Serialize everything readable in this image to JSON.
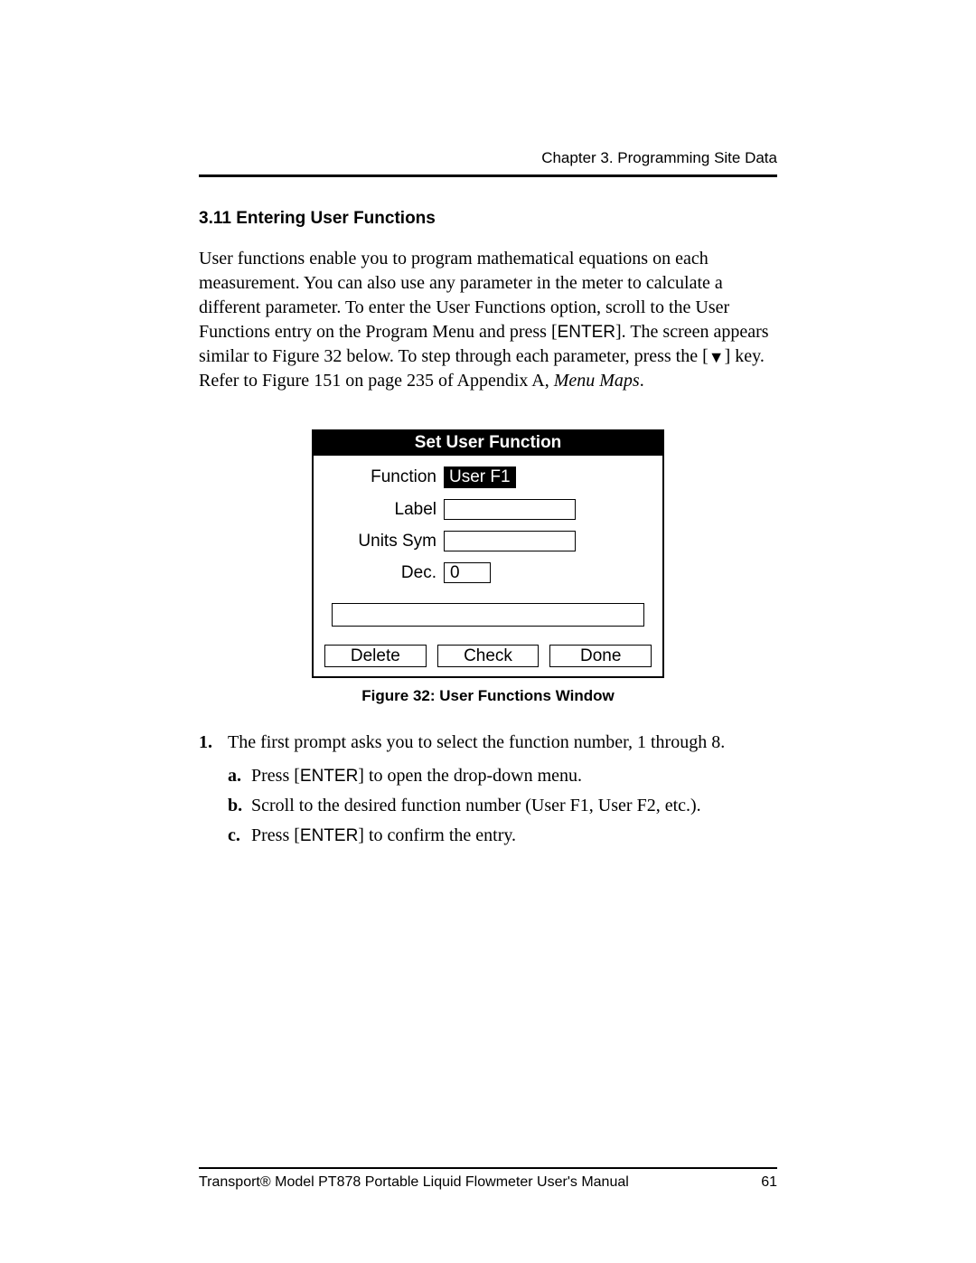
{
  "header": {
    "chapter": "Chapter 3. Programming Site Data"
  },
  "section": {
    "heading": "3.11 Entering User Functions",
    "para_part1": "User functions enable you to program mathematical equations on each measurement. You can also use any parameter in the meter to calculate a different parameter. To enter the User Functions option, scroll to the User Functions entry on the Program Menu and press [",
    "enter1": "ENTER",
    "para_part2": "]. The screen appears similar to Figure 32 below. To step through each parameter, press the [",
    "down_symbol": "▼",
    "para_part3": "] key. Refer to Figure 151 on page 235 of Appendix A, ",
    "menu_maps": "Menu Maps",
    "para_part4": "."
  },
  "window": {
    "title": "Set User Function",
    "rows": {
      "function_label": "Function",
      "function_value": "User F1",
      "label_label": "Label",
      "units_label": "Units Sym",
      "dec_label": "Dec.",
      "dec_value": "0"
    },
    "buttons": {
      "delete": "Delete",
      "check": "Check",
      "done": "Done"
    },
    "caption": "Figure 32: User Functions Window"
  },
  "steps": {
    "num1": "1.",
    "text1": "The first prompt asks you to select the function number, 1 through 8.",
    "a_letter": "a.",
    "a_text_pre": "Press [",
    "a_enter": "ENTER",
    "a_text_post": "] to open the drop-down menu.",
    "b_letter": "b.",
    "b_text": "Scroll to the desired function number (User F1, User F2, etc.).",
    "c_letter": "c.",
    "c_text_pre": "Press [",
    "c_enter": "ENTER",
    "c_text_post": "] to confirm the entry."
  },
  "footer": {
    "left": "Transport® Model PT878 Portable Liquid Flowmeter User's Manual",
    "page": "61"
  }
}
